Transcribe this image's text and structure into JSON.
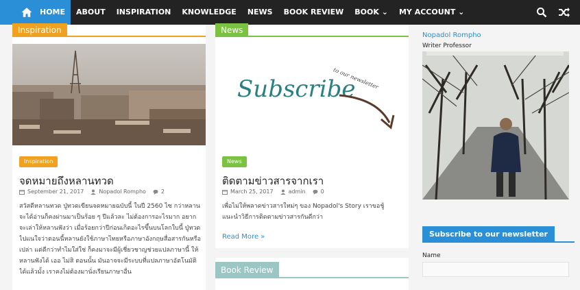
{
  "nav": {
    "items": [
      "HOME",
      "ABOUT",
      "INSPIRATION",
      "KNOWLEDGE",
      "NEWS",
      "BOOK REVIEW",
      "BOOK ⌄",
      "MY ACCOUNT ⌄"
    ],
    "home_icon": "home-icon",
    "search_icon": "search-icon",
    "random_icon": "shuffle-icon",
    "accent": "#2a8fd6"
  },
  "left": {
    "section": "Inspiration",
    "section_color": "#f0a11f",
    "badge": "Inspiration",
    "title": "จดหมายถึงหลานทวด",
    "date": "September 21, 2017",
    "author": "Nopadol Rompho",
    "comments": "2",
    "excerpt": "สวัสดีหลานทวด ปู่ทวดเขียนจดหมายฉบับนี้ ในปี 2560 ไซ กว่าหลานจะได้อ่านก็คงผ่านมาเป็นร้อย ๆ ปีแล้วละ ไม่ต้องการอะไรมาก อยากจะเล่าให้หลานฟังว่า เมื่อร้อยกว่าปีก่อนเกิดอะไรขึ้นบนโลกใบนี้ ปู่ทวดไปแนใจว่าตอนนี้หลานยังใช้ภาษาไทยหรือภาษาอังกฤษสื่อสารกันหรือเปล่า แต่ดีกว่าทำไมใส่ใช่ ก็คงมาจะมีผู้เชี่ยวชาญช่วยแปลภาษานี้ ให้หลานฟังได้ เออ ไม่สิ ตอนนั้น มันอาจจะมีระบบที่แปลภาษาอัตโนมัติได้แล้วมั้ง เราคงไม่ต้องมานั่งเรียนภาษาอื่น"
  },
  "middle": {
    "section": "News",
    "section_color": "#7cc242",
    "image_text": "Subscribe",
    "image_subtext": "to our newsletter",
    "badge": "News",
    "title": "ติดตามข่าวสารจากเรา",
    "date": "March 25, 2017",
    "author": "admin",
    "comments": "0",
    "excerpt": "เพื่อไม่ให้พลาดข่าวสารใหม่ๆ ของ Nopadol's Story เราขอชู้แนะนำวิธีการติดตามข่าวสารกันดีกว่า",
    "read_more": "Read More »",
    "section2": "Book Review",
    "section2_color": "#9cc6c4"
  },
  "right": {
    "author_name": "Nopadol Rompho",
    "author_role": "Writer Professor",
    "widget_title": "Subscribe to our newsletter",
    "field_label": "Name"
  }
}
